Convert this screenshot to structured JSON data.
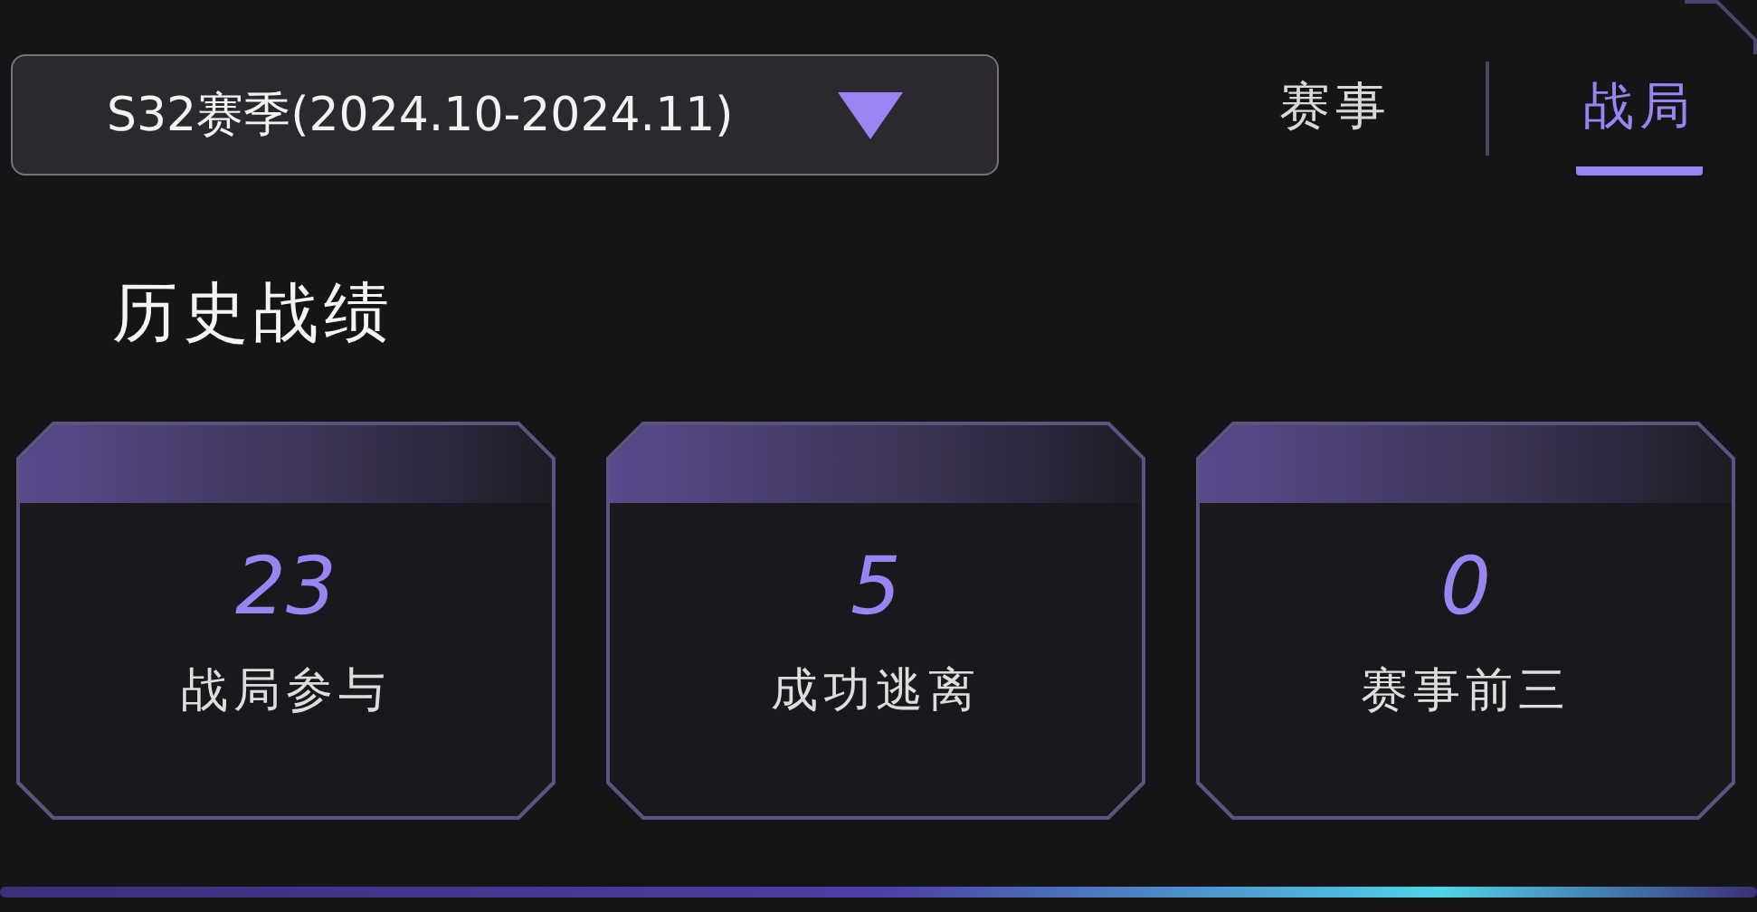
{
  "season_dropdown": {
    "value": "S32赛季(2024.10-2024.11)"
  },
  "tabs": [
    {
      "label": "赛事",
      "selected": false
    },
    {
      "label": "战局",
      "selected": true
    }
  ],
  "section_title": "历史战绩",
  "stats": [
    {
      "value": "23",
      "label": "战局参与"
    },
    {
      "value": "5",
      "label": "成功逃离"
    },
    {
      "value": "0",
      "label": "赛事前三"
    }
  ]
}
